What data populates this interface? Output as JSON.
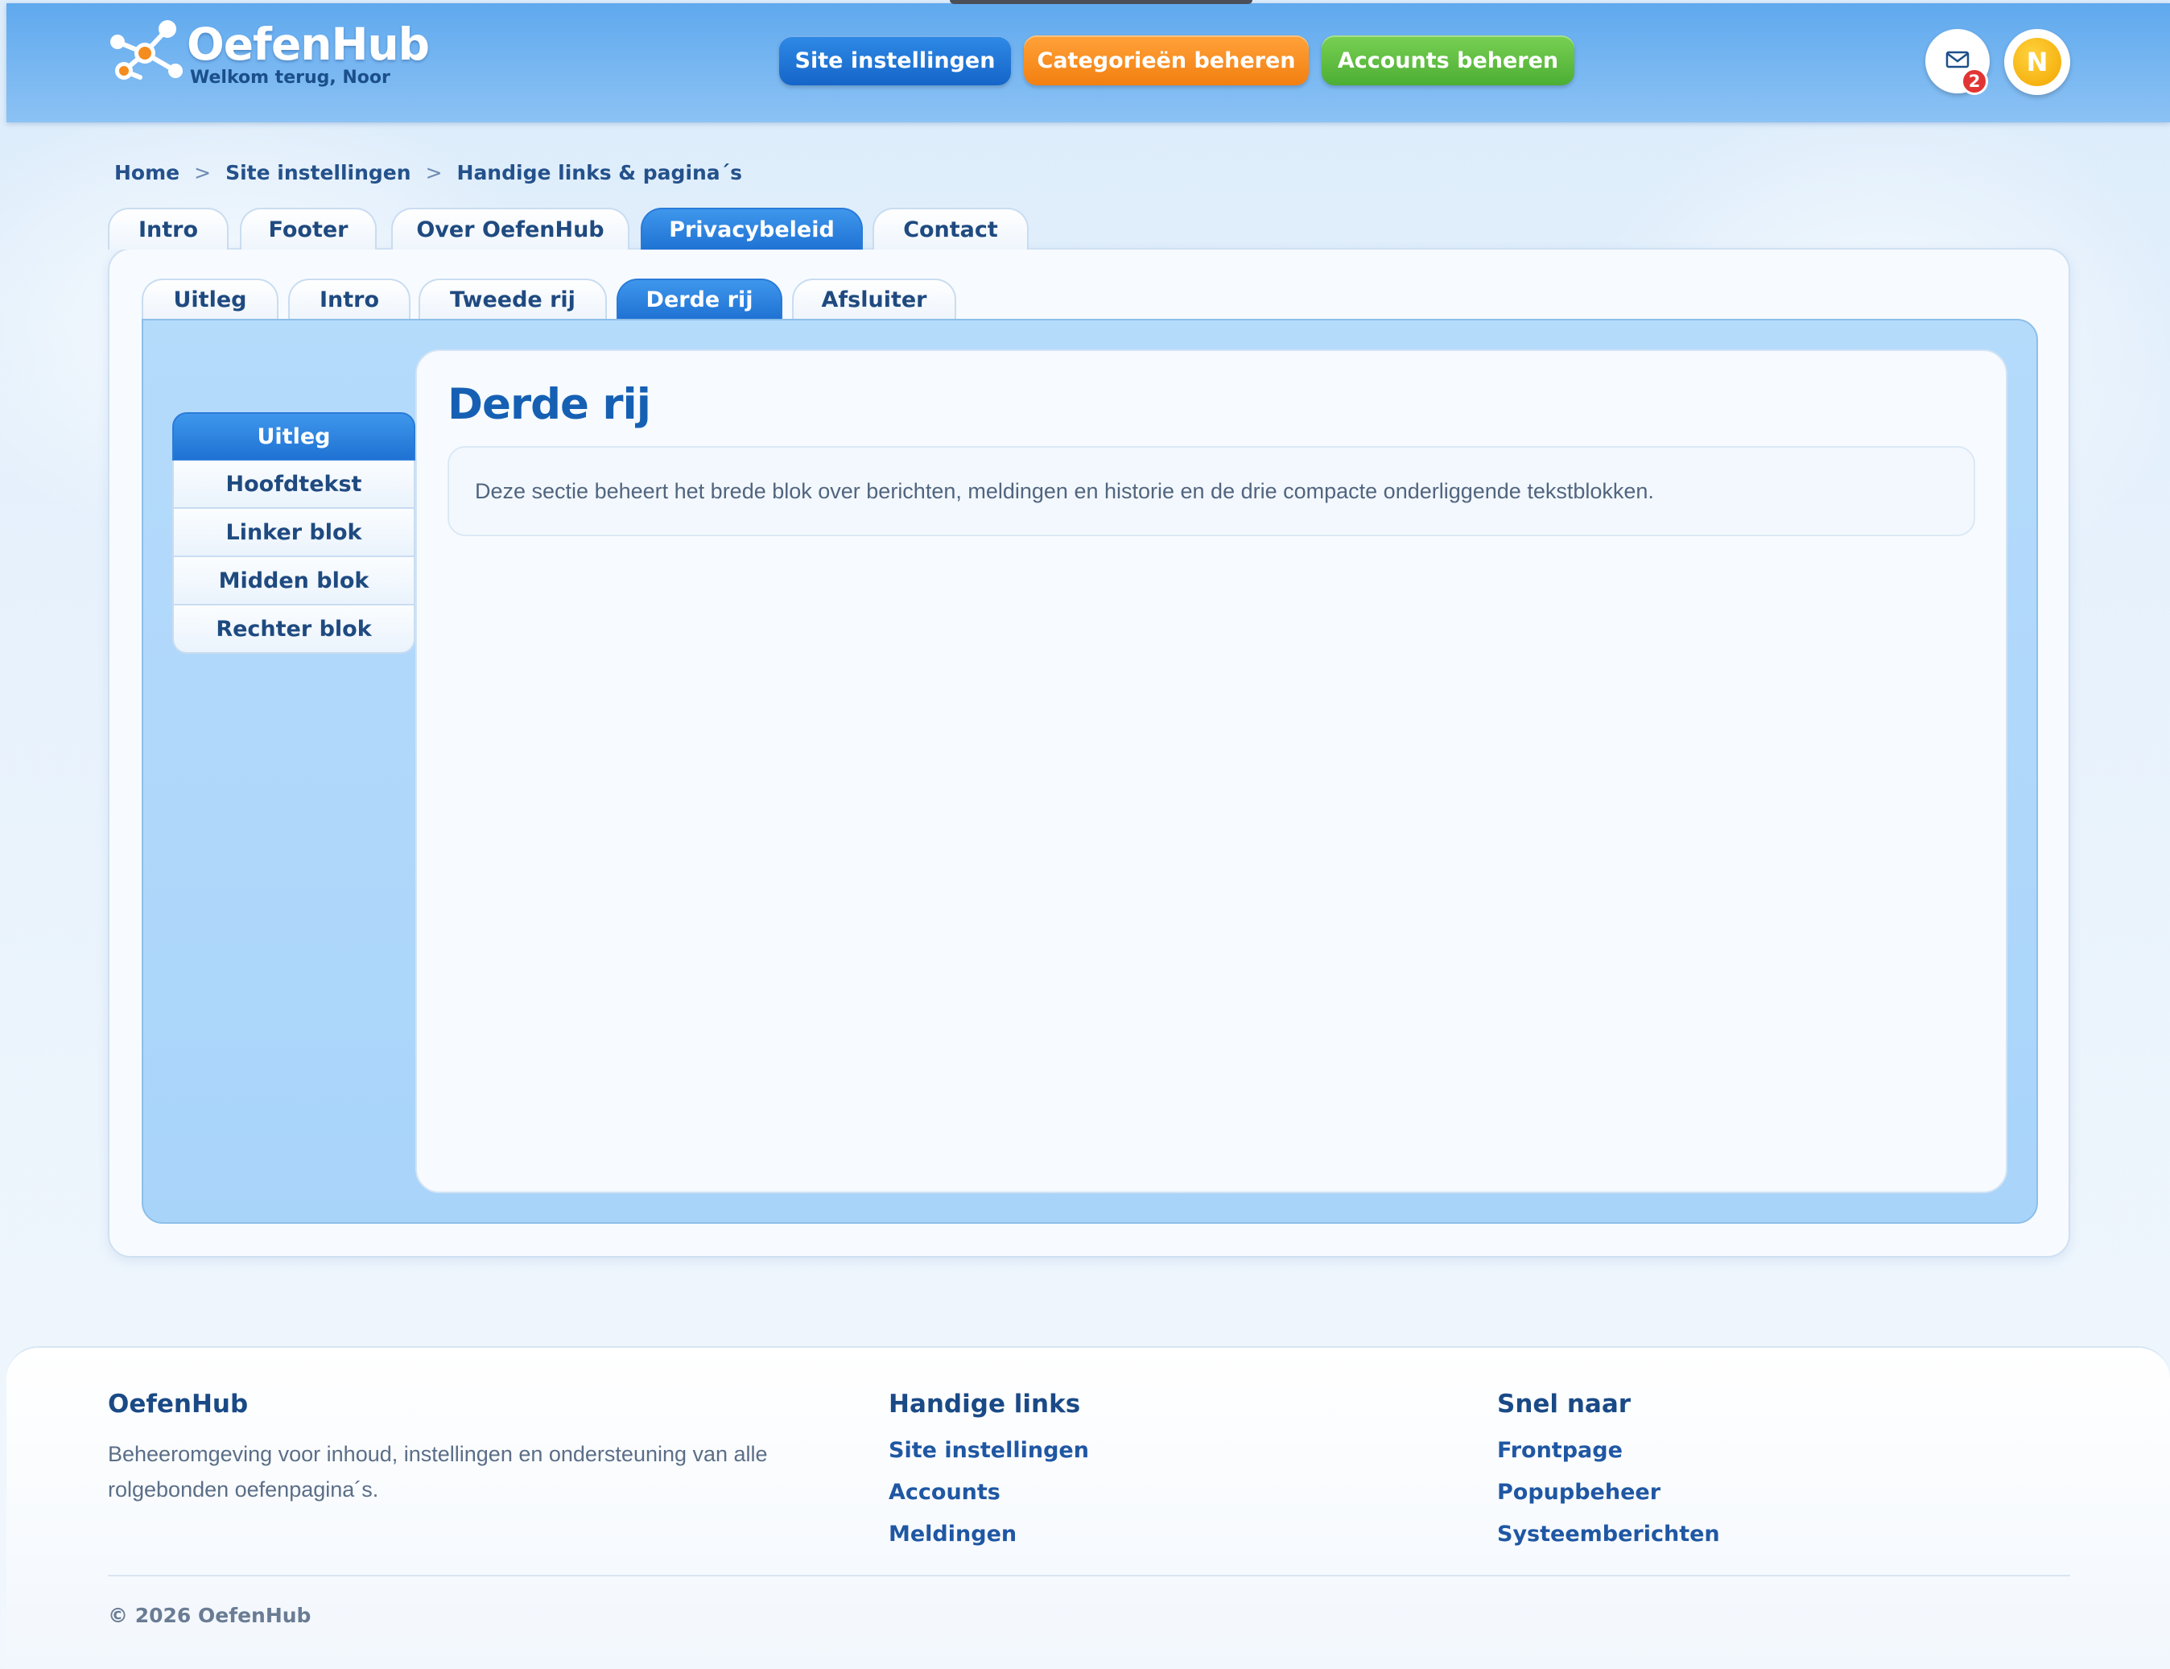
{
  "app": {
    "name": "OefenHub",
    "welcome": "Welkom terug, Noor",
    "avatar_letter": "N"
  },
  "nav": {
    "site_settings": "Site instellingen",
    "categories": "Categorieën beheren",
    "accounts": "Accounts beheren"
  },
  "notifications": {
    "icon": "mail-icon",
    "count": "2"
  },
  "breadcrumb": {
    "items": [
      "Home",
      "Site instellingen",
      "Handige links & pagina´s"
    ],
    "separator": ">"
  },
  "tabs": {
    "items": [
      "Intro",
      "Footer",
      "Over OefenHub",
      "Privacybeleid",
      "Contact"
    ],
    "active": "Privacybeleid"
  },
  "subtabs": {
    "items": [
      "Uitleg",
      "Intro",
      "Tweede rij",
      "Derde rij",
      "Afsluiter"
    ],
    "active": "Derde rij"
  },
  "side_menu": {
    "items": [
      "Uitleg",
      "Hoofdtekst",
      "Linker blok",
      "Midden blok",
      "Rechter blok"
    ],
    "active": "Uitleg"
  },
  "content": {
    "title": "Derde rij",
    "description": "Deze sectie beheert het brede blok over berichten, meldingen en historie en de drie compacte onderliggende tekstblokken."
  },
  "footer": {
    "brand_title": "OefenHub",
    "brand_desc": "Beheeromgeving voor inhoud, instellingen en ondersteuning van alle rolgebonden oefenpagina´s.",
    "links_title": "Handige links",
    "links": [
      "Site instellingen",
      "Accounts",
      "Meldingen"
    ],
    "quick_title": "Snel naar",
    "quick": [
      "Frontpage",
      "Popupbeheer",
      "Systeemberichten"
    ],
    "copyright": "© 2026 OefenHub"
  },
  "colors": {
    "primary_blue": "#1f72d3",
    "orange": "#f37f10",
    "green": "#4cae34",
    "badge_red": "#e23434"
  }
}
